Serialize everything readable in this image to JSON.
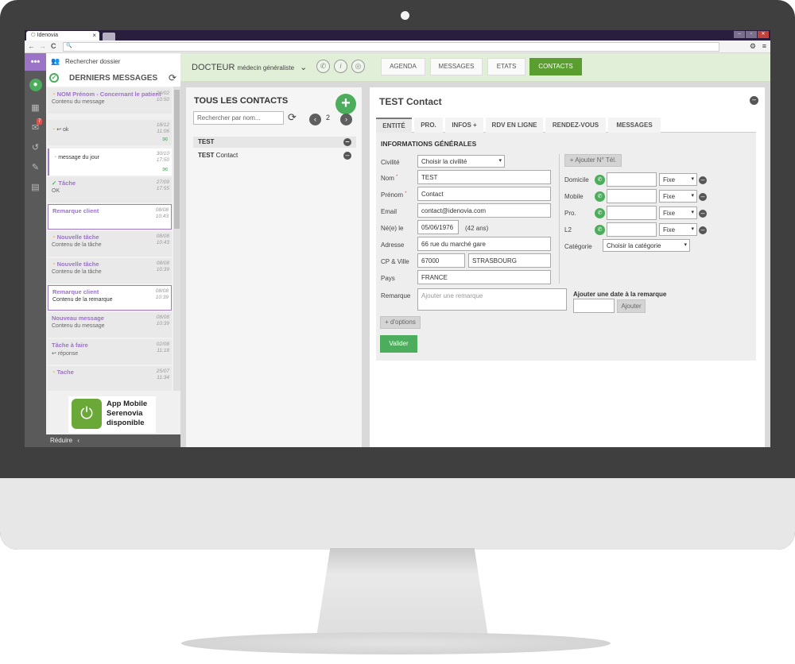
{
  "browser": {
    "tab_title": "Idenovia",
    "tab_close": "×",
    "back": "←",
    "forward": "→",
    "reload": "C",
    "url_icon": "🔍",
    "settings_icon": "⚙",
    "menu_icon": "≡",
    "url": ""
  },
  "window_controls": [
    "–",
    "▫",
    "✕"
  ],
  "iconbar": {
    "dots": "•••",
    "badge": "7"
  },
  "left_panel": {
    "search_label": "Rechercher dossier",
    "heading": "DERNIERS MESSAGES",
    "reduce_label": "Réduire",
    "app_text": [
      "App Mobile",
      "Serenovia",
      "disponible"
    ],
    "messages": [
      {
        "title": "NOM Prénom -  Concernant le patient",
        "sub": "Contenu du message",
        "date1": "26/02",
        "date2": "10:50"
      },
      {
        "title": "ok",
        "sub": "",
        "date1": "18/12",
        "date2": "11:06"
      },
      {
        "title": "message du jour",
        "sub": "",
        "date1": "30/10",
        "date2": "17:50"
      },
      {
        "title": "Tâche",
        "sub": "OK",
        "date1": "27/09",
        "date2": "17:55"
      },
      {
        "title": "Remarque client",
        "sub": "",
        "date1": "08/08",
        "date2": "10:43"
      },
      {
        "title": "Nouvelle tâche",
        "sub": "Contenu de la tâche",
        "date1": "08/08",
        "date2": "10:43"
      },
      {
        "title": "Nouvelle tâche",
        "sub": "Contenu de la tâche",
        "date1": "08/08",
        "date2": "10:39"
      },
      {
        "title": "Remarque client",
        "sub": "Contenu de la remarque",
        "date1": "08/08",
        "date2": "10:39"
      },
      {
        "title": "Nouveau message",
        "sub": "Contenu du message",
        "date1": "08/08",
        "date2": "10:39"
      },
      {
        "title": "Tâche à faire",
        "sub": "réponse",
        "date1": "02/08",
        "date2": "11:18"
      },
      {
        "title": "Tache",
        "sub": "",
        "date1": "25/07",
        "date2": "11:34"
      }
    ]
  },
  "topbar": {
    "doctor": "DOCTEUR",
    "specialty": "médecin généraliste",
    "nav": [
      "AGENDA",
      "MESSAGES",
      "ETATS",
      "CONTACTS"
    ]
  },
  "contacts": {
    "title": "TOUS LES CONTACTS",
    "search_placeholder": "Rechercher par nom...",
    "page": "2",
    "prev": "‹",
    "next": "›",
    "rows": [
      {
        "bold": "TEST",
        "rest": ""
      },
      {
        "bold": "TEST",
        "rest": " Contact"
      }
    ]
  },
  "form": {
    "title": "TEST Contact",
    "tabs": [
      "ENTITÉ",
      "PRO.",
      "INFOS +",
      "RDV EN LIGNE",
      "RENDEZ-VOUS",
      "MESSAGES"
    ],
    "section": "INFORMATIONS GÉNÉRALES",
    "labels": {
      "civilite": "Civilité",
      "nom": "Nom",
      "prenom": "Prénom",
      "email": "Email",
      "ne": "Né(e) le",
      "adresse": "Adresse",
      "cpville": "CP & Ville",
      "pays": "Pays",
      "remarque": "Remarque"
    },
    "values": {
      "civilite": "Choisir la civilité",
      "nom": "TEST",
      "prenom": "Contact",
      "email": "contact@idenovia.com",
      "ne": "05/06/1976",
      "age": "(42 ans)",
      "adresse": "66 rue du marché gare",
      "cp": "67000",
      "ville": "STRASBOURG",
      "pays": "FRANCE"
    },
    "remarque_placeholder": "Ajouter une remarque",
    "date_label": "Ajouter une date à la remarque",
    "ajouter": "Ajouter",
    "options": "+ d'options",
    "valider": "Valider",
    "phone_add": "+ Ajouter N° Tél.",
    "phones": [
      {
        "label": "Domicile",
        "type": "Fixe"
      },
      {
        "label": "Mobile",
        "type": "Fixe"
      },
      {
        "label": "Pro.",
        "type": "Fixe"
      },
      {
        "label": "L2",
        "type": "Fixe"
      }
    ],
    "categorie_label": "Catégorie",
    "categorie_value": "Choisir la catégorie"
  }
}
